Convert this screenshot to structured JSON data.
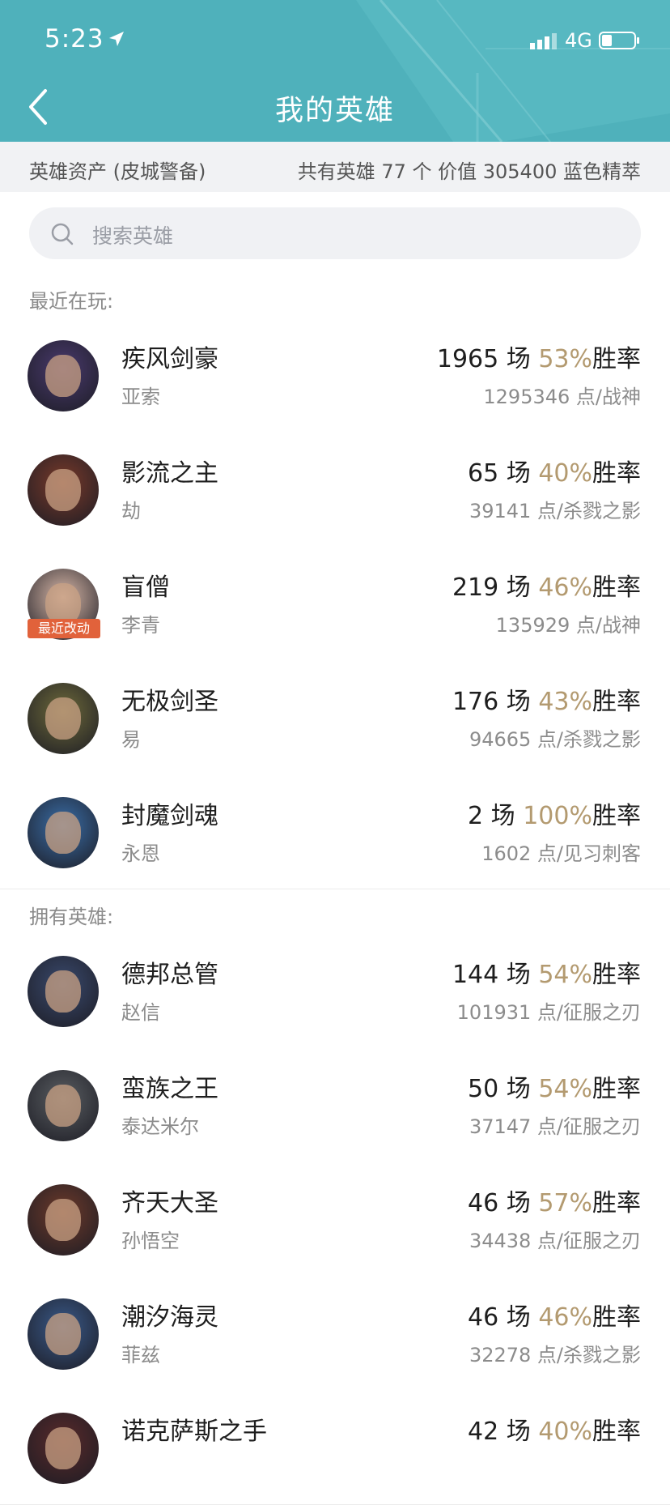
{
  "status": {
    "time": "5:23",
    "network": "4G"
  },
  "header": {
    "title": "我的英雄"
  },
  "summary": {
    "left": "英雄资产 (皮城警备)",
    "right": "共有英雄 77 个  价值 305400 蓝色精萃"
  },
  "search": {
    "placeholder": "搜索英雄"
  },
  "sections": {
    "recent": "最近在玩:",
    "owned": "拥有英雄:"
  },
  "colors": {
    "header_bg": "#4fb1bb",
    "win_rate": "#b39a70",
    "badge_bg": "#e1623b"
  },
  "recent": [
    {
      "title": "疾风剑豪",
      "name": "亚索",
      "games": "1965 场",
      "rate": "53%",
      "rate_suffix": "胜率",
      "points": "1295346 点/战神",
      "badge": "",
      "avatar_color": "#4a3a6e"
    },
    {
      "title": "影流之主",
      "name": "劫",
      "games": "65 场",
      "rate": "40%",
      "rate_suffix": "胜率",
      "points": "39141 点/杀戮之影",
      "badge": "",
      "avatar_color": "#7a3a2a"
    },
    {
      "title": "盲僧",
      "name": "李青",
      "games": "219 场",
      "rate": "46%",
      "rate_suffix": "胜率",
      "points": "135929 点/战神",
      "badge": "最近改动",
      "avatar_color": "#d9b8a8"
    },
    {
      "title": "无极剑圣",
      "name": "易",
      "games": "176 场",
      "rate": "43%",
      "rate_suffix": "胜率",
      "points": "94665 点/杀戮之影",
      "badge": "",
      "avatar_color": "#6e6a3a"
    },
    {
      "title": "封魔剑魂",
      "name": "永恩",
      "games": "2 场",
      "rate": "100%",
      "rate_suffix": "胜率",
      "points": "1602 点/见习刺客",
      "badge": "",
      "avatar_color": "#3a6ea8"
    }
  ],
  "owned": [
    {
      "title": "德邦总管",
      "name": "赵信",
      "games": "144 场",
      "rate": "54%",
      "rate_suffix": "胜率",
      "points": "101931 点/征服之刃",
      "badge": "",
      "avatar_color": "#3a4a6e"
    },
    {
      "title": "蛮族之王",
      "name": "泰达米尔",
      "games": "50 场",
      "rate": "54%",
      "rate_suffix": "胜率",
      "points": "37147 点/征服之刃",
      "badge": "",
      "avatar_color": "#5a5e62"
    },
    {
      "title": "齐天大圣",
      "name": "孙悟空",
      "games": "46 场",
      "rate": "57%",
      "rate_suffix": "胜率",
      "points": "34438 点/征服之刃",
      "badge": "",
      "avatar_color": "#6e3a2a"
    },
    {
      "title": "潮汐海灵",
      "name": "菲兹",
      "games": "46 场",
      "rate": "46%",
      "rate_suffix": "胜率",
      "points": "32278 点/杀戮之影",
      "badge": "",
      "avatar_color": "#3a5a8a"
    },
    {
      "title": "诺克萨斯之手",
      "name": "",
      "games": "42 场",
      "rate": "40%",
      "rate_suffix": "胜率",
      "points": "",
      "badge": "",
      "avatar_color": "#5a2a2a"
    }
  ]
}
